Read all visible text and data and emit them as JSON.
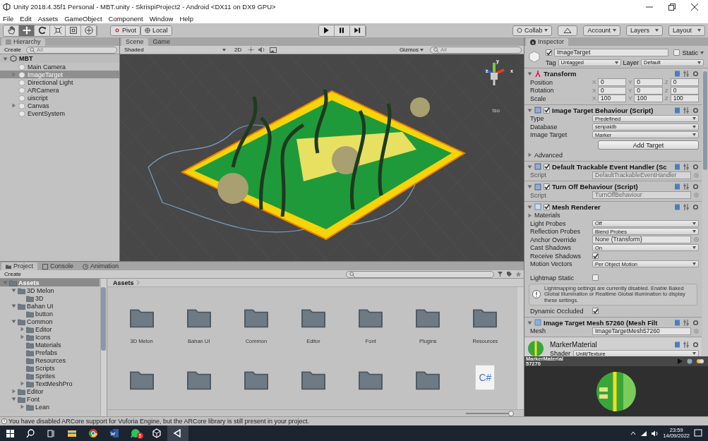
{
  "window": {
    "title": "Unity 2018.4.35f1 Personal - MBT.unity - SkrispiProject2 - Android <DX11 on DX9 GPU>"
  },
  "menu": [
    "File",
    "Edit",
    "Assets",
    "GameObject",
    "Component",
    "Window",
    "Help"
  ],
  "toolbar": {
    "tools": [
      {
        "kind": "hand",
        "selected": false
      },
      {
        "kind": "move",
        "selected": true
      },
      {
        "kind": "rotate",
        "selected": false
      },
      {
        "kind": "scale",
        "selected": false
      },
      {
        "kind": "rect",
        "selected": false
      },
      {
        "kind": "transform",
        "selected": false
      }
    ],
    "pivot": "Pivot",
    "space": "Local",
    "playback": [
      {
        "kind": "play"
      },
      {
        "kind": "pause"
      },
      {
        "kind": "step"
      }
    ],
    "right_buttons": [
      {
        "kind": "collab",
        "label": "Collab"
      },
      {
        "kind": "cloud"
      },
      {
        "kind": "dropdown",
        "label": "Account"
      },
      {
        "kind": "dropdown",
        "label": "Layers"
      },
      {
        "kind": "dropdown",
        "label": "Layout"
      }
    ]
  },
  "hierarchy": {
    "title": "Hierarchy",
    "create": "Create",
    "search_placeholder": "All",
    "scene": "MBT",
    "items": [
      {
        "label": "Main Camera",
        "selected": false,
        "has_children": false
      },
      {
        "label": "ImageTarget",
        "selected": true,
        "has_children": true
      },
      {
        "label": "Directional Light",
        "selected": false,
        "has_children": false
      },
      {
        "label": "ARCamera",
        "selected": false,
        "has_children": false
      },
      {
        "label": "uiscript",
        "selected": false,
        "has_children": false
      },
      {
        "label": "Canvas",
        "selected": false,
        "has_children": true
      },
      {
        "label": "EventSystem",
        "selected": false,
        "has_children": false
      }
    ]
  },
  "scene": {
    "tabs": [
      {
        "label": "Scene",
        "selected": true
      },
      {
        "label": "Game",
        "selected": false
      }
    ],
    "shading": "Shaded",
    "mode_2d": "2D",
    "gizmos": "Gizmos",
    "search_placeholder": "All",
    "axes": [
      "y",
      "z",
      "x"
    ],
    "projection": "Iso"
  },
  "inspector": {
    "title": "Inspector",
    "object": {
      "name": "ImageTarget",
      "active": true,
      "static_label": "Static",
      "static": false,
      "tag_label": "Tag",
      "tag": "Untagged",
      "layer_label": "Layer",
      "layer": "Default"
    },
    "components": [
      {
        "kind": "transform",
        "title": "Transform",
        "fields": [
          {
            "kind": "vector",
            "label": "Position",
            "values": [
              {
                "axis": "X",
                "value": "0"
              },
              {
                "axis": "Y",
                "value": "0"
              },
              {
                "axis": "Z",
                "value": "0"
              }
            ]
          },
          {
            "kind": "vector",
            "label": "Rotation",
            "values": [
              {
                "axis": "X",
                "value": "0"
              },
              {
                "axis": "Y",
                "value": "0"
              },
              {
                "axis": "Z",
                "value": "0"
              }
            ]
          },
          {
            "kind": "vector",
            "label": "Scale",
            "values": [
              {
                "axis": "X",
                "value": "100"
              },
              {
                "axis": "Y",
                "value": "100"
              },
              {
                "axis": "Z",
                "value": "100"
              }
            ]
          }
        ]
      },
      {
        "kind": "script",
        "title": "Image Target Behaviour (Script)",
        "enabled": true,
        "fields": [
          {
            "kind": "dropdown",
            "label": "Type",
            "value": "Predefined"
          },
          {
            "kind": "dropdown",
            "label": "Database",
            "value": "senpaidb"
          },
          {
            "kind": "dropdown",
            "label": "Image Target",
            "value": "Marker"
          },
          {
            "kind": "button",
            "label": "Add Target"
          },
          {
            "kind": "foldout",
            "label": "Advanced"
          }
        ]
      },
      {
        "kind": "script",
        "title": "Default Trackable Event Handler (Sc",
        "enabled": true,
        "fields": [
          {
            "kind": "object",
            "label": "Script",
            "value": "DefaultTrackableEventHandler",
            "disabled": true
          }
        ]
      },
      {
        "kind": "script",
        "title": "Turn Off Behaviour (Script)",
        "enabled": true,
        "fields": [
          {
            "kind": "object",
            "label": "Script",
            "value": "TurnOffBehaviour",
            "disabled": true
          }
        ]
      },
      {
        "kind": "renderer",
        "title": "Mesh Renderer",
        "enabled": true,
        "fields": [
          {
            "kind": "foldout",
            "label": "Materials"
          },
          {
            "kind": "dropdown",
            "label": "Light Probes",
            "value": "Off"
          },
          {
            "kind": "dropdown",
            "label": "Reflection Probes",
            "value": "Blend Probes"
          },
          {
            "kind": "object",
            "label": "Anchor Override",
            "value": "None (Transform)",
            "disabled": false
          },
          {
            "kind": "dropdown",
            "label": "Cast Shadows",
            "value": "On"
          },
          {
            "kind": "checkbox",
            "label": "Receive Shadows",
            "checked": true
          },
          {
            "kind": "dropdown",
            "label": "Motion Vectors",
            "value": "Per Object Motion"
          },
          {
            "kind": "checkbox",
            "label": "Lightmap Static",
            "checked": false,
            "gap": true
          },
          {
            "kind": "help",
            "text": "Lightmapping settings are currently disabled. Enable Baked Global Illumination or Realtime Global Illumination to display these settings."
          },
          {
            "kind": "checkbox",
            "label": "Dynamic Occluded",
            "checked": true
          }
        ]
      },
      {
        "kind": "mesh",
        "title": "Image Target Mesh 57260 (Mesh Filt",
        "fields": [
          {
            "kind": "object",
            "label": "Mesh",
            "value": "ImageTargetMesh57260",
            "disabled": false
          }
        ]
      },
      {
        "kind": "material",
        "title": "MarkerMaterial",
        "shader_label": "Shader",
        "shader": "Unlit/Texture"
      }
    ],
    "preview": {
      "title": "MarkerMaterial 57270"
    }
  },
  "project": {
    "tabs": [
      {
        "label": "Project",
        "selected": true
      },
      {
        "label": "Console",
        "selected": false
      },
      {
        "label": "Animation",
        "selected": false
      }
    ],
    "create": "Create",
    "tree": [
      {
        "label": "Assets",
        "selected": true,
        "expanded": true,
        "children": [
          {
            "label": "3D Melon",
            "selected": false,
            "expanded": true,
            "children": [
              {
                "label": "3D",
                "selected": false
              }
            ]
          },
          {
            "label": "Bahan UI",
            "selected": false,
            "expanded": true,
            "children": [
              {
                "label": "button",
                "selected": false
              }
            ]
          },
          {
            "label": "Common",
            "selected": false,
            "expanded": true,
            "children": [
              {
                "label": "Editor",
                "selected": false,
                "expanded": false
              },
              {
                "label": "Icons",
                "selected": false,
                "expanded": false
              },
              {
                "label": "Materials",
                "selected": false
              },
              {
                "label": "Prefabs",
                "selected": false
              },
              {
                "label": "Resources",
                "selected": false
              },
              {
                "label": "Scripts",
                "selected": false
              },
              {
                "label": "Sprites",
                "selected": false
              },
              {
                "label": "TextMeshPro",
                "selected": false,
                "expanded": false
              }
            ]
          },
          {
            "label": "Editor",
            "selected": false,
            "expanded": false
          },
          {
            "label": "Font",
            "selected": false,
            "expanded": true,
            "children": [
              {
                "label": "Lean",
                "selected": false,
                "expanded": false
              }
            ]
          }
        ]
      }
    ],
    "breadcrumb": "Assets",
    "zoom": {
      "level": 1
    },
    "items": [
      {
        "kind": "folder",
        "label": "3D Melon"
      },
      {
        "kind": "folder",
        "label": "Bahan UI"
      },
      {
        "kind": "folder",
        "label": "Common"
      },
      {
        "kind": "folder",
        "label": "Editor"
      },
      {
        "kind": "folder",
        "label": "Font"
      },
      {
        "kind": "folder",
        "label": "Plugins"
      },
      {
        "kind": "folder",
        "label": "Resources"
      },
      {
        "kind": "folder"
      },
      {
        "kind": "folder"
      },
      {
        "kind": "folder"
      },
      {
        "kind": "folder"
      },
      {
        "kind": "folder"
      },
      {
        "kind": "folder"
      },
      {
        "kind": "script",
        "icon_text": "C#"
      }
    ]
  },
  "status": {
    "message": "You have disabled ARCore support for Vuforia Engine, but the ARCore library is still present in your project."
  },
  "taskbar": {
    "apps": [
      {
        "kind": "files",
        "active": false
      },
      {
        "kind": "browser",
        "active": false
      },
      {
        "kind": "word",
        "active": false
      },
      {
        "kind": "chat",
        "active": false,
        "badge": "5"
      },
      {
        "kind": "cube",
        "active": false
      },
      {
        "kind": "unity",
        "active": true
      }
    ],
    "time": "23:59",
    "date": "14/09/2022"
  }
}
